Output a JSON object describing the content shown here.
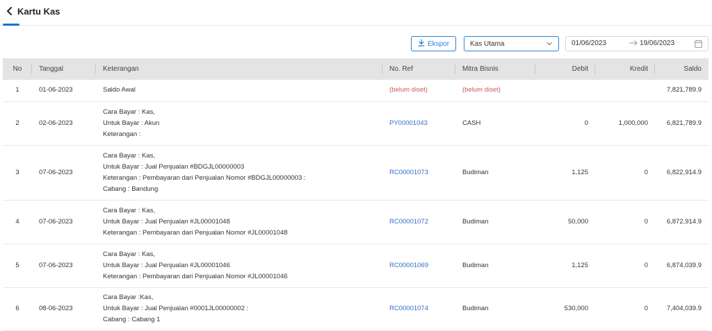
{
  "header": {
    "title": "Kartu Kas"
  },
  "toolbar": {
    "export_label": "Ekspor",
    "account_selected": "Kas Utama",
    "date_start": "01/06/2023",
    "date_end": "19/06/2023"
  },
  "table": {
    "columns": [
      "No",
      "Tanggal",
      "Keterangan",
      "No. Ref",
      "Mitra Bisnis",
      "Debit",
      "Kredit",
      "Saldo"
    ],
    "rows": [
      {
        "no": "1",
        "tanggal": "01-06-2023",
        "keterangan": [
          "Saldo Awal"
        ],
        "ref": "(belum diset)",
        "mitra": "(belum diset)",
        "debit": "",
        "kredit": "",
        "saldo": "7,821,789.9"
      },
      {
        "no": "2",
        "tanggal": "02-06-2023",
        "keterangan": [
          "Cara Bayar : Kas,",
          "Untuk Bayar : Akun",
          "Keterangan :"
        ],
        "ref": "PY00001043",
        "mitra": "CASH",
        "debit": "0",
        "kredit": "1,000,000",
        "saldo": "6,821,789.9"
      },
      {
        "no": "3",
        "tanggal": "07-06-2023",
        "keterangan": [
          "Cara Bayar : Kas,",
          "Untuk Bayar : Jual Penjualan #BDGJL00000003",
          "Keterangan : Pembayaran dari Penjualan Nomor #BDGJL00000003 :",
          "Cabang : Bandung"
        ],
        "ref": "RC00001073",
        "mitra": "Budiman",
        "debit": "1,125",
        "kredit": "0",
        "saldo": "6,822,914.9"
      },
      {
        "no": "4",
        "tanggal": "07-06-2023",
        "keterangan": [
          "Cara Bayar : Kas,",
          "Untuk Bayar : Jual Penjualan #JL00001048",
          "Keterangan : Pembayaran dari Penjualan Nomor #JL00001048"
        ],
        "ref": "RC00001072",
        "mitra": "Budiman",
        "debit": "50,000",
        "kredit": "0",
        "saldo": "6,872,914.9"
      },
      {
        "no": "5",
        "tanggal": "07-06-2023",
        "keterangan": [
          "Cara Bayar : Kas,",
          "Untuk Bayar : Jual Penjualan #JL00001046",
          "Keterangan : Pembayaran dari Penjualan Nomor #JL00001046"
        ],
        "ref": "RC00001069",
        "mitra": "Budiman",
        "debit": "1,125",
        "kredit": "0",
        "saldo": "6,874,039.9"
      },
      {
        "no": "6",
        "tanggal": "08-06-2023",
        "keterangan": [
          "Cara Bayar :Kas,",
          "Untuk Bayar : Jual Penjualan #0001JL00000002 :",
          "Cabang : Cabang 1"
        ],
        "ref": "RC00001074",
        "mitra": "Budiman",
        "debit": "530,000",
        "kredit": "0",
        "saldo": "7,404,039.9"
      }
    ]
  }
}
